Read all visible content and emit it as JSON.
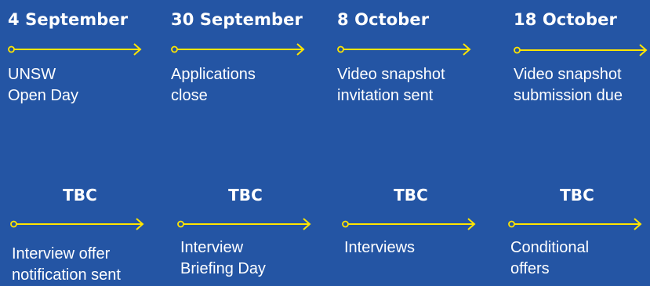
{
  "accent_color": "#FFE500",
  "background_color": "#2455A4",
  "arrow_icon": "timeline-arrow-icon",
  "timeline_top": [
    {
      "date": "4 September",
      "lines": [
        "UNSW",
        "Open Day"
      ]
    },
    {
      "date": "30 September",
      "lines": [
        "Applications",
        "close"
      ]
    },
    {
      "date": "8 October",
      "lines": [
        "Video snapshot",
        "invitation sent"
      ]
    },
    {
      "date": "18 October",
      "lines": [
        "Video snapshot",
        "submission due"
      ]
    }
  ],
  "timeline_bottom": [
    {
      "date": "TBC",
      "lines": [
        "Interview offer",
        "notification sent"
      ]
    },
    {
      "date": "TBC",
      "lines": [
        "Interview",
        "Briefing Day"
      ]
    },
    {
      "date": "TBC",
      "lines": [
        "Interviews"
      ]
    },
    {
      "date": "TBC",
      "lines": [
        "Conditional",
        "offers"
      ]
    }
  ]
}
